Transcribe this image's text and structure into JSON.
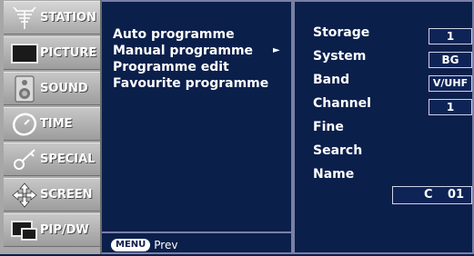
{
  "sidebar": {
    "items": [
      {
        "label": "STATION",
        "icon": "antenna-icon"
      },
      {
        "label": "PICTURE",
        "icon": "tv-screen-icon"
      },
      {
        "label": "SOUND",
        "icon": "speaker-icon"
      },
      {
        "label": "TIME",
        "icon": "clock-icon"
      },
      {
        "label": "SPECIAL",
        "icon": "key-icon"
      },
      {
        "label": "SCREEN",
        "icon": "move-arrows-icon"
      },
      {
        "label": "PIP/DW",
        "icon": "pip-icon"
      }
    ]
  },
  "submenu": {
    "items": [
      {
        "label": "Auto programme"
      },
      {
        "label": "Manual programme",
        "arrow": "►"
      },
      {
        "label": "Programme edit"
      },
      {
        "label": "Favourite programme"
      }
    ],
    "footer": {
      "menu_badge": "MENU",
      "prev_label": "Prev"
    }
  },
  "settings": {
    "storage": {
      "label": "Storage",
      "value": "1"
    },
    "system": {
      "label": "System",
      "value": "BG"
    },
    "band": {
      "label": "Band",
      "value": "V/UHF"
    },
    "channel": {
      "label": "Channel",
      "value": "1"
    },
    "fine": {
      "label": "Fine"
    },
    "search": {
      "label": "Search"
    },
    "name": {
      "label": "Name",
      "letter": "C",
      "number": "01"
    }
  },
  "colors": {
    "panel_bg": "#0b1f4b",
    "sidebar_bg": "#a7a7a7",
    "text": "#ffffff"
  }
}
